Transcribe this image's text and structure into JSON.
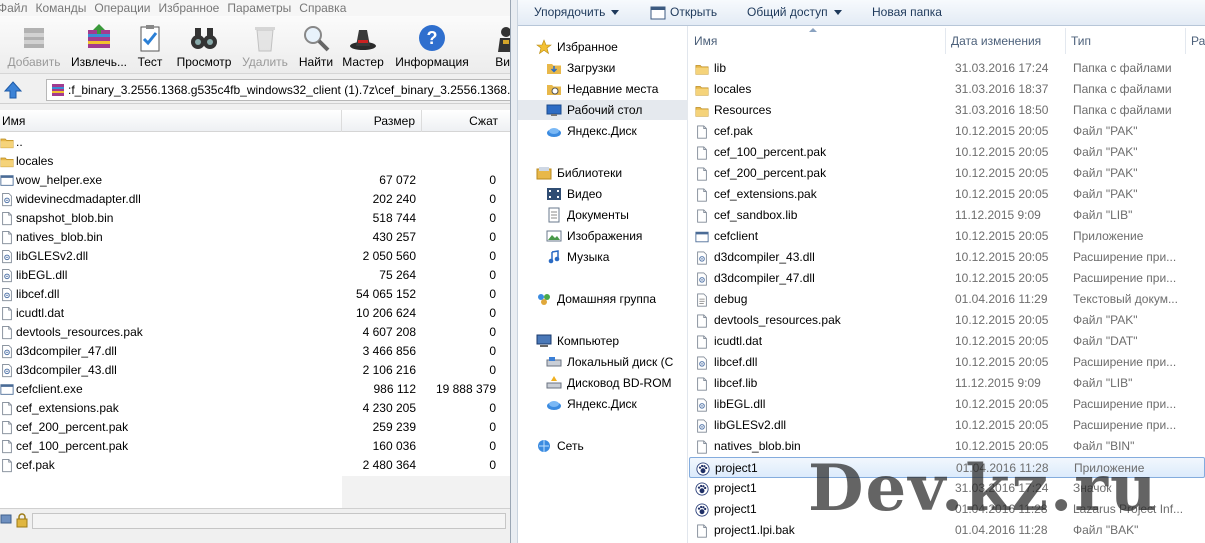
{
  "winrar": {
    "menu": [
      "Файл",
      "Команды",
      "Операции",
      "Избранное",
      "Параметры",
      "Справка"
    ],
    "toolbar": [
      {
        "label": "Добавить",
        "icon": "add-archive-icon",
        "enabled": false
      },
      {
        "label": "Извлечь...",
        "icon": "extract-icon",
        "enabled": true
      },
      {
        "label": "Тест",
        "icon": "test-clipboard-icon",
        "enabled": true
      },
      {
        "label": "Просмотр",
        "icon": "binoculars-icon",
        "enabled": true
      },
      {
        "label": "Удалить",
        "icon": "trash-icon",
        "enabled": false
      },
      {
        "label": "Найти",
        "icon": "magnifier-icon",
        "enabled": true
      },
      {
        "label": "Мастер",
        "icon": "wizard-hat-icon",
        "enabled": true
      },
      {
        "label": "Информация",
        "icon": "info-icon",
        "enabled": true
      },
      {
        "label": "Вир",
        "icon": "virus-scan-icon",
        "enabled": true
      }
    ],
    "path": ":f_binary_3.2556.1368.g535c4fb_windows32_client (1).7z\\cef_binary_3.2556.1368.g535",
    "columns": {
      "name": "Имя",
      "size": "Размер",
      "packed": "Сжат"
    },
    "files": [
      {
        "name": "..",
        "type": "folder",
        "size": "",
        "packed": ""
      },
      {
        "name": "locales",
        "type": "folder",
        "size": "",
        "packed": ""
      },
      {
        "name": "wow_helper.exe",
        "type": "exe",
        "size": "67 072",
        "packed": "0"
      },
      {
        "name": "widevinecdmadapter.dll",
        "type": "dll",
        "size": "202 240",
        "packed": "0"
      },
      {
        "name": "snapshot_blob.bin",
        "type": "file",
        "size": "518 744",
        "packed": "0"
      },
      {
        "name": "natives_blob.bin",
        "type": "file",
        "size": "430 257",
        "packed": "0"
      },
      {
        "name": "libGLESv2.dll",
        "type": "dll",
        "size": "2 050 560",
        "packed": "0"
      },
      {
        "name": "libEGL.dll",
        "type": "dll",
        "size": "75 264",
        "packed": "0"
      },
      {
        "name": "libcef.dll",
        "type": "dll",
        "size": "54 065 152",
        "packed": "0"
      },
      {
        "name": "icudtl.dat",
        "type": "file",
        "size": "10 206 624",
        "packed": "0"
      },
      {
        "name": "devtools_resources.pak",
        "type": "file",
        "size": "4 607 208",
        "packed": "0"
      },
      {
        "name": "d3dcompiler_47.dll",
        "type": "dll",
        "size": "3 466 856",
        "packed": "0"
      },
      {
        "name": "d3dcompiler_43.dll",
        "type": "dll",
        "size": "2 106 216",
        "packed": "0"
      },
      {
        "name": "cefclient.exe",
        "type": "exe",
        "size": "986 112",
        "packed": "19 888 379"
      },
      {
        "name": "cef_extensions.pak",
        "type": "file",
        "size": "4 230 205",
        "packed": "0"
      },
      {
        "name": "cef_200_percent.pak",
        "type": "file",
        "size": "259 239",
        "packed": "0"
      },
      {
        "name": "cef_100_percent.pak",
        "type": "file",
        "size": "160 036",
        "packed": "0"
      },
      {
        "name": "cef.pak",
        "type": "file",
        "size": "2 480 364",
        "packed": "0"
      }
    ]
  },
  "explorer": {
    "commands": {
      "organize": "Упорядочить",
      "open": "Открыть",
      "share": "Общий доступ",
      "new_folder": "Новая папка"
    },
    "nav": [
      {
        "label": "Избранное",
        "icon": "star-icon",
        "level": 0,
        "group": 0
      },
      {
        "label": "Загрузки",
        "icon": "downloads-folder-icon",
        "level": 1,
        "group": 0
      },
      {
        "label": "Недавние места",
        "icon": "recent-places-icon",
        "level": 1,
        "group": 0
      },
      {
        "label": "Рабочий стол",
        "icon": "desktop-icon",
        "level": 1,
        "group": 0,
        "selected": true
      },
      {
        "label": "Яндекс.Диск",
        "icon": "yandex-disk-icon",
        "level": 1,
        "group": 0
      },
      {
        "label": "Библиотеки",
        "icon": "libraries-icon",
        "level": 0,
        "group": 1
      },
      {
        "label": "Видео",
        "icon": "video-icon",
        "level": 1,
        "group": 1
      },
      {
        "label": "Документы",
        "icon": "documents-icon",
        "level": 1,
        "group": 1
      },
      {
        "label": "Изображения",
        "icon": "images-icon",
        "level": 1,
        "group": 1
      },
      {
        "label": "Музыка",
        "icon": "music-icon",
        "level": 1,
        "group": 1
      },
      {
        "label": "Домашняя группа",
        "icon": "homegroup-icon",
        "level": 0,
        "group": 2
      },
      {
        "label": "Компьютер",
        "icon": "computer-icon",
        "level": 0,
        "group": 3
      },
      {
        "label": "Локальный диск (C",
        "icon": "local-disk-icon",
        "level": 1,
        "group": 3
      },
      {
        "label": "Дисковод BD-ROM",
        "icon": "bd-rom-icon",
        "level": 1,
        "group": 3
      },
      {
        "label": "Яндекс.Диск",
        "icon": "yandex-disk-icon",
        "level": 1,
        "group": 3
      },
      {
        "label": "Сеть",
        "icon": "network-icon",
        "level": 0,
        "group": 4
      }
    ],
    "columns": {
      "name": "Имя",
      "date": "Дата изменения",
      "type": "Тип",
      "size": "Ра"
    },
    "files": [
      {
        "name": "lib",
        "date": "31.03.2016 17:24",
        "type": "Папка с файлами",
        "icon": "folder"
      },
      {
        "name": "locales",
        "date": "31.03.2016 18:37",
        "type": "Папка с файлами",
        "icon": "folder"
      },
      {
        "name": "Resources",
        "date": "31.03.2016 18:50",
        "type": "Папка с файлами",
        "icon": "folder"
      },
      {
        "name": "cef.pak",
        "date": "10.12.2015 20:05",
        "type": "Файл \"PAK\"",
        "icon": "file"
      },
      {
        "name": "cef_100_percent.pak",
        "date": "10.12.2015 20:05",
        "type": "Файл \"PAK\"",
        "icon": "file"
      },
      {
        "name": "cef_200_percent.pak",
        "date": "10.12.2015 20:05",
        "type": "Файл \"PAK\"",
        "icon": "file"
      },
      {
        "name": "cef_extensions.pak",
        "date": "10.12.2015 20:05",
        "type": "Файл \"PAK\"",
        "icon": "file"
      },
      {
        "name": "cef_sandbox.lib",
        "date": "11.12.2015 9:09",
        "type": "Файл \"LIB\"",
        "icon": "file"
      },
      {
        "name": "cefclient",
        "date": "10.12.2015 20:05",
        "type": "Приложение",
        "icon": "app"
      },
      {
        "name": "d3dcompiler_43.dll",
        "date": "10.12.2015 20:05",
        "type": "Расширение при...",
        "icon": "dll"
      },
      {
        "name": "d3dcompiler_47.dll",
        "date": "10.12.2015 20:05",
        "type": "Расширение при...",
        "icon": "dll"
      },
      {
        "name": "debug",
        "date": "01.04.2016 11:29",
        "type": "Текстовый докум...",
        "icon": "text"
      },
      {
        "name": "devtools_resources.pak",
        "date": "10.12.2015 20:05",
        "type": "Файл \"PAK\"",
        "icon": "file"
      },
      {
        "name": "icudtl.dat",
        "date": "10.12.2015 20:05",
        "type": "Файл \"DAT\"",
        "icon": "file"
      },
      {
        "name": "libcef.dll",
        "date": "10.12.2015 20:05",
        "type": "Расширение при...",
        "icon": "dll"
      },
      {
        "name": "libcef.lib",
        "date": "11.12.2015 9:09",
        "type": "Файл \"LIB\"",
        "icon": "file"
      },
      {
        "name": "libEGL.dll",
        "date": "10.12.2015 20:05",
        "type": "Расширение при...",
        "icon": "dll"
      },
      {
        "name": "libGLESv2.dll",
        "date": "10.12.2015 20:05",
        "type": "Расширение при...",
        "icon": "dll"
      },
      {
        "name": "natives_blob.bin",
        "date": "10.12.2015 20:05",
        "type": "Файл \"BIN\"",
        "icon": "file"
      },
      {
        "name": "project1",
        "date": "01.04.2016 11:28",
        "type": "Приложение",
        "icon": "paw",
        "selected": true
      },
      {
        "name": "project1",
        "date": "31.03.2016 17:24",
        "type": "Значок",
        "icon": "paw"
      },
      {
        "name": "project1",
        "date": "01.04.2016 11:28",
        "type": "Lazarus Project Inf...",
        "icon": "paw"
      },
      {
        "name": "project1.lpi.bak",
        "date": "01.04.2016 11:28",
        "type": "Файл \"BAK\"",
        "icon": "file"
      }
    ]
  },
  "watermark": "Dev.kz.ru",
  "colors": {
    "folder": "#e8b84a",
    "selection": "#dcebfc",
    "selection_border": "#84acdd",
    "command_text": "#1e395b",
    "header_text": "#4c607a"
  }
}
